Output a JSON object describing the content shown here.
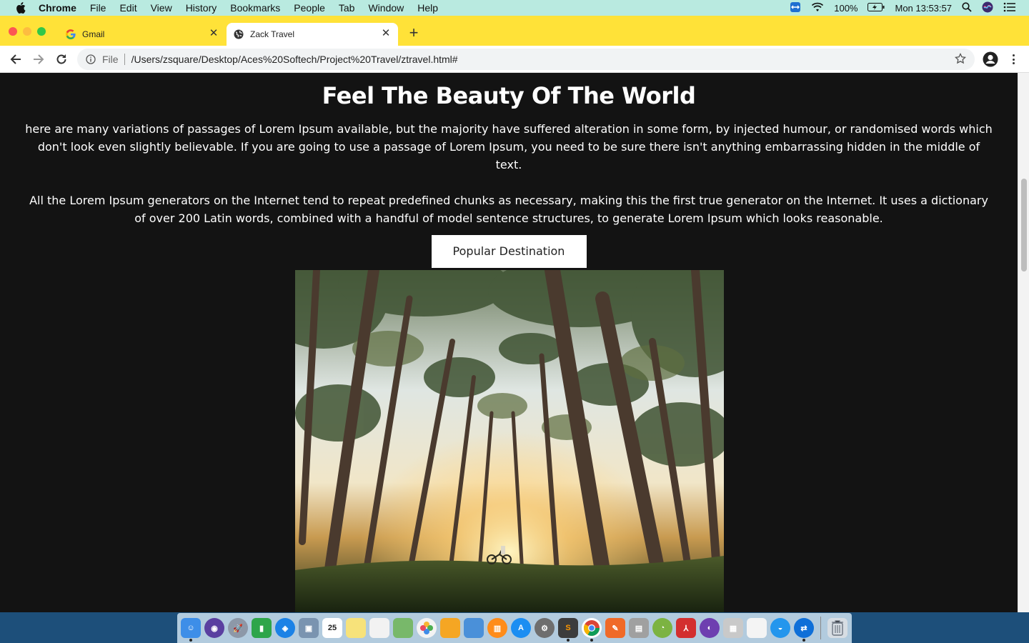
{
  "menubar": {
    "items": [
      "Chrome",
      "File",
      "Edit",
      "View",
      "History",
      "Bookmarks",
      "People",
      "Tab",
      "Window",
      "Help"
    ],
    "battery": "100%",
    "clock": "Mon 13:53:57"
  },
  "tabs": [
    {
      "title": "Gmail",
      "favicon": "google-icon"
    },
    {
      "title": "Zack Travel",
      "favicon": "globe-icon"
    }
  ],
  "omnibox": {
    "scheme": "File",
    "url": "/Users/zsquare/Desktop/Aces%20Softech/Project%20Travel/ztravel.html#"
  },
  "page": {
    "heading": "Feel The Beauty Of The World",
    "paragraph_1": "here are many variations of passages of Lorem Ipsum available, but the majority have suffered alteration in some form, by injected humour, or randomised words which don't look even slightly believable. If you are going to use a passage of Lorem Ipsum, you need to be sure there isn't anything embarrassing hidden in the middle of text.",
    "paragraph_2": "All the Lorem Ipsum generators on the Internet tend to repeat predefined chunks as necessary, making this the first true generator on the Internet. It uses a dictionary of over 200 Latin words, combined with a handful of model sentence structures, to generate Lorem Ipsum which looks reasonable.",
    "button_label": "Popular Destination",
    "image": "forest-photo"
  },
  "dock": {
    "apps": [
      "finder",
      "siri",
      "launchpad",
      "numbers",
      "safari",
      "preview",
      "calendar",
      "notes",
      "reminders",
      "maps",
      "photos",
      "pages",
      "keynote",
      "books",
      "app-store",
      "system-preferences",
      "sublime-text",
      "chrome",
      "pencil",
      "storyboard",
      "android-studio",
      "acrobat",
      "github",
      "archive",
      "textedit",
      "docker",
      "teamviewer",
      "trash"
    ],
    "calendar_day": "25"
  },
  "colors": {
    "menubar": "#b9eae0",
    "tabstrip": "#ffe238",
    "page_bg": "#131313"
  }
}
